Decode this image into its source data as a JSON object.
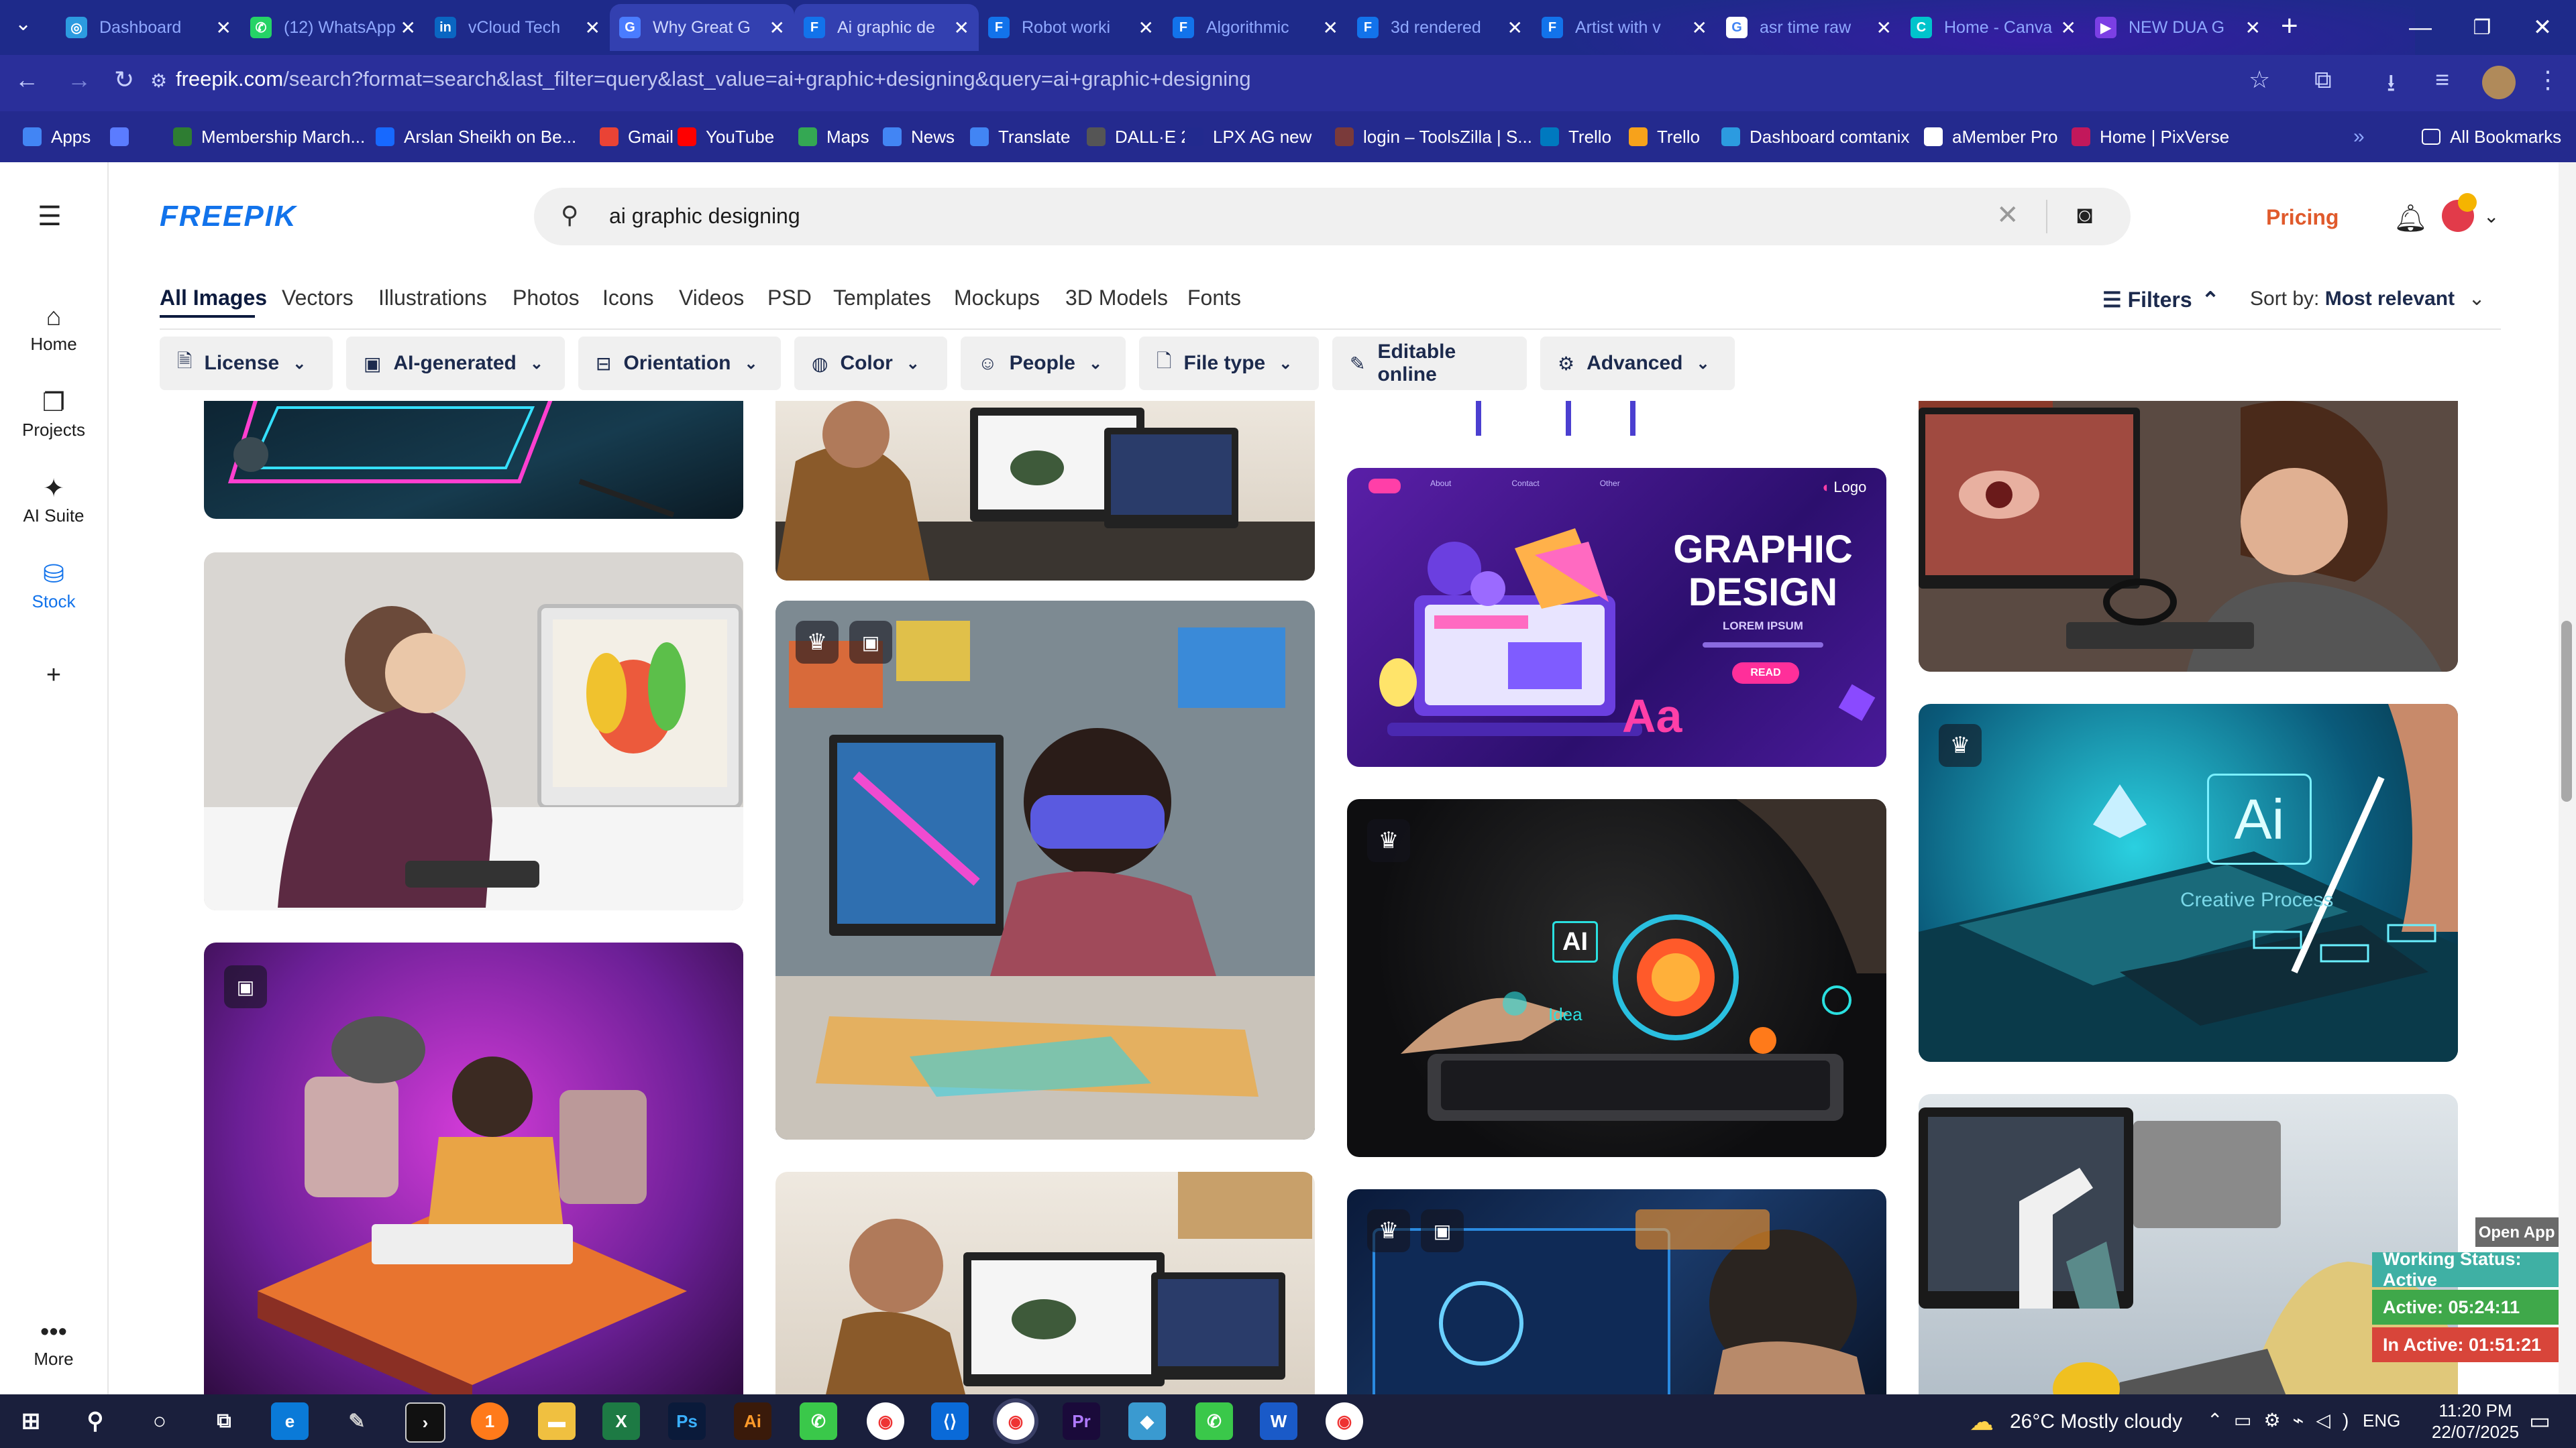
{
  "browser": {
    "tabs": [
      {
        "title": "Dashboard",
        "color": "#2c9be0",
        "glyph": "◎"
      },
      {
        "title": "(12) WhatsApp",
        "color": "#25d366",
        "glyph": "✆"
      },
      {
        "title": "vCloud Tech",
        "color": "#0a66c2",
        "glyph": "in"
      },
      {
        "title": "Why Great G",
        "color": "#4a7cff",
        "glyph": "G"
      },
      {
        "title": "Ai graphic de",
        "color": "#1273eb",
        "glyph": "F"
      },
      {
        "title": "Robot worki",
        "color": "#1273eb",
        "glyph": "F"
      },
      {
        "title": "Algorithmic",
        "color": "#1273eb",
        "glyph": "F"
      },
      {
        "title": "3d rendered",
        "color": "#1273eb",
        "glyph": "F"
      },
      {
        "title": "Artist with v",
        "color": "#1273eb",
        "glyph": "F"
      },
      {
        "title": "asr time raw",
        "color": "#ffffff",
        "glyph": "G"
      },
      {
        "title": "Home - Canva",
        "color": "#00c4cc",
        "glyph": "C"
      },
      {
        "title": "NEW DUA G",
        "color": "#7b3fe4",
        "glyph": "▶"
      }
    ],
    "url_main": "freepik.com",
    "url_rest": "/search?format=search&last_filter=query&last_value=ai+graphic+designing&query=ai+graphic+designing",
    "bookmarks": [
      {
        "label": "Apps",
        "color": "#4285f4"
      },
      {
        "label": "",
        "color": "#5b7cff"
      },
      {
        "label": "Membership March...",
        "color": "#2e7d32"
      },
      {
        "label": "Arslan Sheikh on Be...",
        "color": "#1769ff"
      },
      {
        "label": "Gmail",
        "color": "#ea4335"
      },
      {
        "label": "YouTube",
        "color": "#ff0000"
      },
      {
        "label": "Maps",
        "color": "#34a853"
      },
      {
        "label": "News",
        "color": "#4285f4"
      },
      {
        "label": "Translate",
        "color": "#4285f4"
      },
      {
        "label": "DALL·E 2",
        "color": "#555555"
      },
      {
        "label": "LPX AG new",
        "color": "#222a8e"
      },
      {
        "label": "login – ToolsZilla | S...",
        "color": "#7a3a3a"
      },
      {
        "label": "Trello",
        "color": "#0079bf"
      },
      {
        "label": "Trello",
        "color": "#f7a21b"
      },
      {
        "label": "Dashboard comtanix",
        "color": "#2c9be0"
      },
      {
        "label": "aMember Pro",
        "color": "#ffffff"
      },
      {
        "label": "Home | PixVerse",
        "color": "#c2185b"
      }
    ],
    "all_bookmarks": "All Bookmarks"
  },
  "leftnav": [
    {
      "label": "Home",
      "icon": "home-icon",
      "glyph": "⌂"
    },
    {
      "label": "Projects",
      "icon": "projects-icon",
      "glyph": "❐"
    },
    {
      "label": "AI Suite",
      "icon": "sparkle-icon",
      "glyph": "✦"
    },
    {
      "label": "Stock",
      "icon": "stock-icon",
      "glyph": "⛁"
    },
    {
      "label": "",
      "icon": "plus-icon",
      "glyph": "+"
    },
    {
      "label": "More",
      "icon": "more-icon",
      "glyph": "•••"
    }
  ],
  "header": {
    "logo": "FREEPIK",
    "search_query": "ai graphic designing",
    "pricing": "Pricing"
  },
  "categories": [
    "All Images",
    "Vectors",
    "Illustrations",
    "Photos",
    "Icons",
    "Videos",
    "PSD",
    "Templates",
    "Mockups",
    "3D Models",
    "Fonts"
  ],
  "filters_label": "Filters",
  "sort": {
    "label": "Sort by:",
    "value": "Most relevant"
  },
  "chips": [
    {
      "label": "License",
      "glyph": "🗎"
    },
    {
      "label": "AI-generated",
      "glyph": "▣"
    },
    {
      "label": "Orientation",
      "glyph": "⊟"
    },
    {
      "label": "Color",
      "glyph": "◍"
    },
    {
      "label": "People",
      "glyph": "☺"
    },
    {
      "label": "File type",
      "glyph": "🗋"
    },
    {
      "label": "Editable online",
      "glyph": "✎"
    },
    {
      "label": "Advanced",
      "glyph": "⚙"
    }
  ],
  "promo_card": {
    "nav": [
      "Home",
      "About",
      "Contact",
      "Other"
    ],
    "logo": "Logo",
    "title1": "GRAPHIC",
    "title2": "DESIGN",
    "subtitle": "LOREM IPSUM",
    "button": "READ",
    "aa": "Aa"
  },
  "idea_card": {
    "ai": "AI",
    "idea": "Idea"
  },
  "tablet_card": {
    "ai": "Ai",
    "caption": "Creative Process"
  },
  "status_widget": {
    "open_app": "Open App ↗",
    "working": "Working Status: Active",
    "active": "Active: 05:24:11",
    "inactive": "In Active: 01:51:21"
  },
  "taskbar": {
    "weather": "26°C  Mostly cloudy",
    "lang": "ENG",
    "time": "11:20 PM",
    "date": "22/07/2025"
  }
}
